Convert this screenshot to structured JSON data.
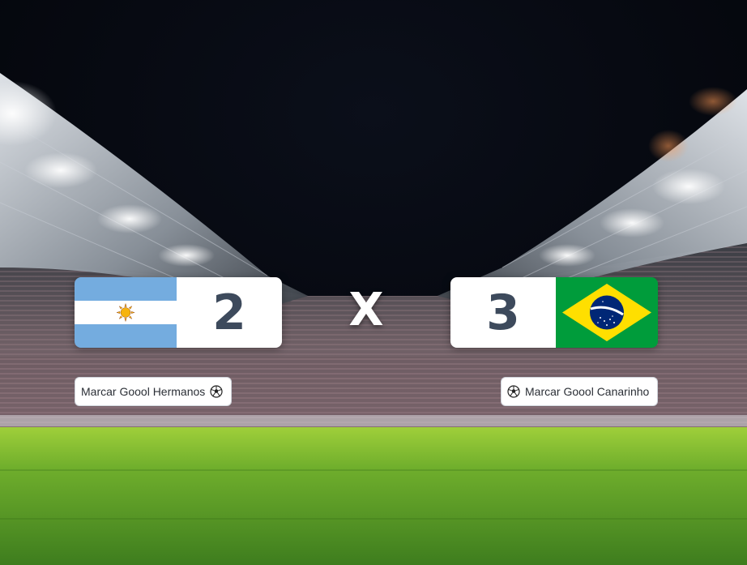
{
  "background": {
    "icon": "stadium-night-background"
  },
  "home_team": {
    "flag_icon": "argentina-flag-icon",
    "score": "2",
    "goal_button_label": "Marcar Goool Hermanos"
  },
  "separator": {
    "label": "X"
  },
  "away_team": {
    "flag_icon": "brazil-flag-icon",
    "score": "3",
    "goal_button_label": "Marcar Goool Canarinho"
  },
  "colors": {
    "score_text": "#3d4a5c",
    "argentina_blue": "#74acdf",
    "brazil_green": "#009c3b",
    "brazil_yellow": "#ffdf00",
    "brazil_blue": "#002776"
  }
}
